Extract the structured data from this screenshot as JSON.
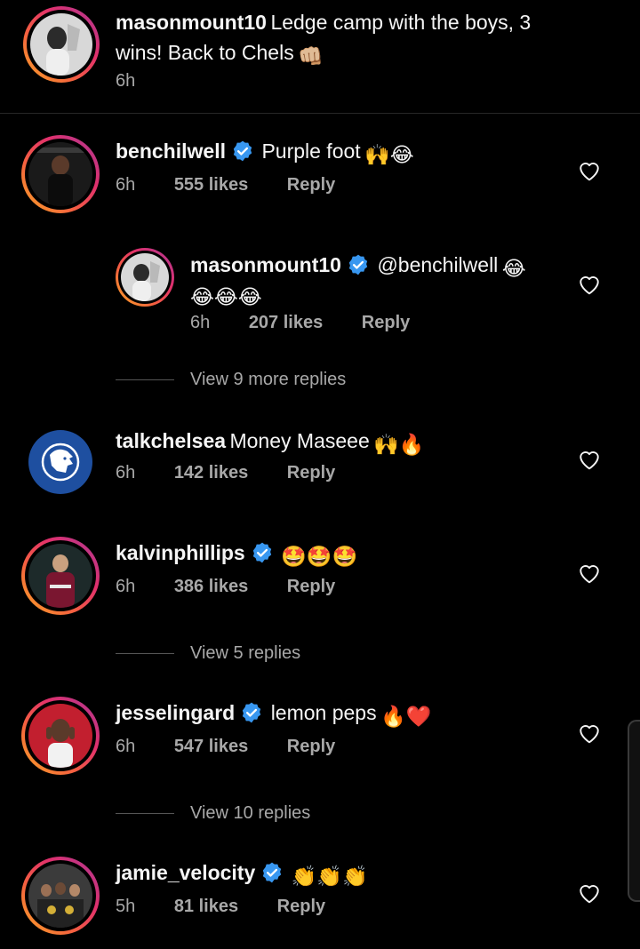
{
  "caption": {
    "username": "masonmount10",
    "text_line1": "Ledge camp with the boys, 3",
    "text_line2": "wins! Back to Chels",
    "emoji": "👊🏼",
    "time": "6h"
  },
  "comments": [
    {
      "username": "benchilwell",
      "verified": true,
      "text": "Purple foot",
      "emoji": "🙌😂",
      "time": "6h",
      "likes": "555 likes",
      "reply": "Reply"
    },
    {
      "username": "masonmount10",
      "verified": true,
      "text": "@benchilwell",
      "emoji": "😂",
      "emoji_line2": "😂😂😂",
      "time": "6h",
      "likes": "207 likes",
      "reply": "Reply"
    },
    {
      "username": "talkchelsea",
      "verified": false,
      "text": "Money Maseee",
      "emoji": "🙌🔥",
      "time": "6h",
      "likes": "142 likes",
      "reply": "Reply"
    },
    {
      "username": "kalvinphillips",
      "verified": true,
      "text": "",
      "emoji": "🤩🤩🤩",
      "time": "6h",
      "likes": "386 likes",
      "reply": "Reply"
    },
    {
      "username": "jesselingard",
      "verified": true,
      "text": "lemon peps",
      "emoji": "🔥❤️",
      "time": "6h",
      "likes": "547 likes",
      "reply": "Reply"
    },
    {
      "username": "jamie_velocity",
      "verified": true,
      "text": "",
      "emoji": "👏👏👏",
      "time": "5h",
      "likes": "81 likes",
      "reply": "Reply"
    }
  ],
  "view_replies": [
    "View 9 more replies",
    "View 5 replies",
    "View 10 replies"
  ],
  "colors": {
    "verified": "#3897f0",
    "text": "#f5f5f5",
    "secondary": "#a8a8a8",
    "talkchelsea_logo": "#1e4fa0"
  },
  "icons": {
    "like": "heart-outline-icon",
    "verified": "verified-badge-icon"
  }
}
